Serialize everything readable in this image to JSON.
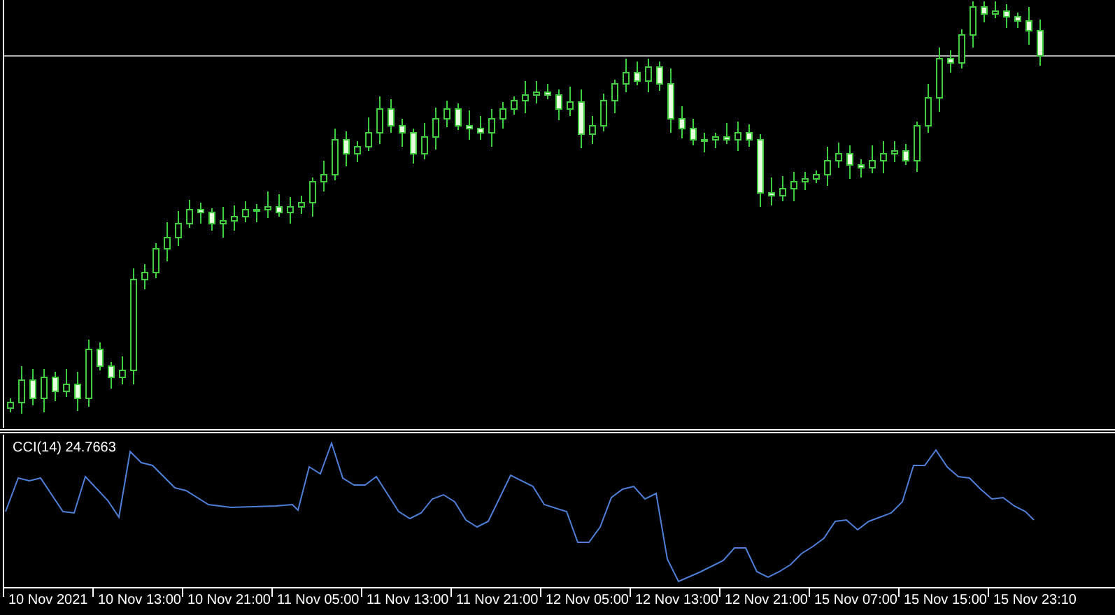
{
  "indicator": {
    "label": "CCI(14) 24.7663"
  },
  "time_axis": {
    "labels": [
      "10 Nov 2021",
      "10 Nov 13:00",
      "10 Nov 21:00",
      "11 Nov 05:00",
      "11 Nov 13:00",
      "11 Nov 21:00",
      "12 Nov 05:00",
      "12 Nov 13:00",
      "12 Nov 21:00",
      "15 Nov 07:00",
      "15 Nov 15:00",
      "15 Nov 23:10"
    ]
  }
}
